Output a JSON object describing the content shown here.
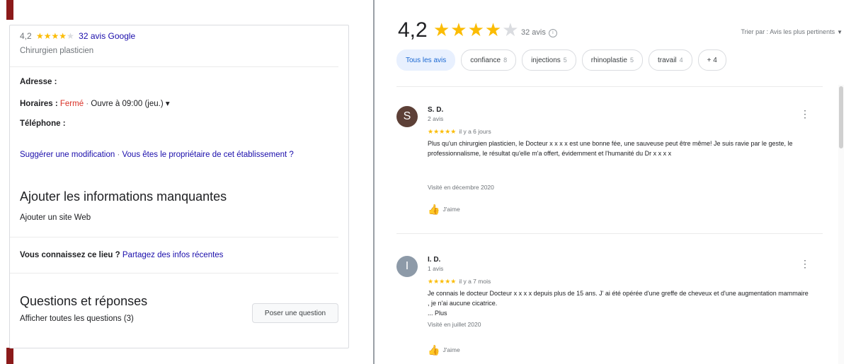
{
  "left_panel": {
    "rating": "4,2",
    "stars_filled": 4,
    "stars_total": 5,
    "reviews_link": "32 avis Google",
    "category": "Chirurgien plasticien",
    "address_label": "Adresse :",
    "hours_label": "Horaires :",
    "hours_status": "Fermé",
    "hours_separator": "·",
    "hours_next": "Ouvre à 09:00 (jeu.)",
    "hours_caret": "▾",
    "phone_label": "Téléphone :",
    "suggest_edit": "Suggérer une modification",
    "suggest_separator": "·",
    "owner_link": "Vous êtes le propriétaire de cet établissement ?",
    "missing_info_title": "Ajouter les informations manquantes",
    "add_website": "Ajouter un site Web",
    "know_place_label": "Vous connaissez ce lieu ?",
    "share_info_link": "Partagez des infos récentes",
    "qa_title": "Questions et réponses",
    "ask_button": "Poser une question",
    "show_questions": "Afficher toutes les questions (3)"
  },
  "right_panel": {
    "rating": "4,2",
    "stars_filled": 4,
    "stars_total": 5,
    "review_count": "32 avis",
    "sort_label": "Trier par : Avis les plus pertinents",
    "chips": [
      {
        "label": "Tous les avis",
        "count": "",
        "active": true
      },
      {
        "label": "confiance",
        "count": "8",
        "active": false
      },
      {
        "label": "injections",
        "count": "5",
        "active": false
      },
      {
        "label": "rhinoplastie",
        "count": "5",
        "active": false
      },
      {
        "label": "travail",
        "count": "4",
        "active": false
      },
      {
        "label": "+ 4",
        "count": "",
        "active": false
      }
    ],
    "reviews": [
      {
        "initial": "S",
        "avatar_color": "#5d4037",
        "name": "S. D.",
        "count": "2 avis",
        "stars": "★★★★★",
        "when": "il y a 6 jours",
        "text": "Plus qu'un chirurgien plasticien, le Docteur x x x x est une bonne fée, une sauveuse peut être même! Je suis ravie par le geste, le professionnalisme, le résultat qu'elle m'a offert, évidemment et l'humanité du Dr x x x x",
        "more": "",
        "visit": "Visité en décembre 2020",
        "like": "J'aime"
      },
      {
        "initial": "I",
        "avatar_color": "#8d9aa8",
        "name": "I. D.",
        "count": "1 avis",
        "stars": "★★★★★",
        "when": "il y a 7 mois",
        "text": "Je connais le docteur Docteur x x x x depuis plus de 15 ans. J' ai été opérée d'une greffe de cheveux et d'une augmentation mammaire , je n'ai aucune cicatrice.",
        "more": "... Plus",
        "visit": "Visité en juillet 2020",
        "like": "J'aime"
      }
    ]
  },
  "colors": {
    "link": "#1a0dab",
    "star": "#fbbc04",
    "closed": "#d93025",
    "accent_bar": "#8b1a1a"
  }
}
